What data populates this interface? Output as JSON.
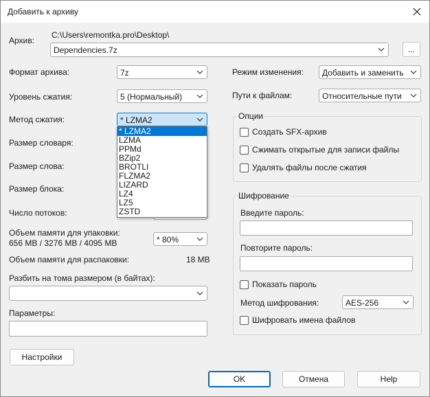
{
  "window": {
    "title": "Добавить к архиву"
  },
  "archive": {
    "label": "Архив:",
    "path": "C:\\Users\\remontka.pro\\Desktop\\",
    "filename": "Dependencies.7z",
    "browse_label": "..."
  },
  "left": {
    "format": {
      "label": "Формат архива:",
      "value": "7z"
    },
    "level": {
      "label": "Уровень сжатия:",
      "value": "5 (Нормальный)"
    },
    "method": {
      "label": "Метод сжатия:",
      "value": "*  LZMA2",
      "options": [
        "*  LZMA2",
        "LZMA",
        "PPMd",
        "BZip2",
        "BROTLI",
        "FLZMA2",
        "LIZARD",
        "LZ4",
        "LZ5",
        "ZSTD"
      ],
      "selected_index": 0
    },
    "dict_label": "Размер словаря:",
    "word_label": "Размер слова:",
    "block_label": "Размер блока:",
    "threads_label": "Число потоков:",
    "mem_pack": {
      "label": "Объем памяти для упаковки:",
      "values": "656 MB / 3276 MB / 4095 MB",
      "percent": "* 80%"
    },
    "mem_unpack": {
      "label": "Объем памяти для распаковки:",
      "value": "18 MB"
    },
    "split": {
      "label": "Разбить на тома размером (в байтах):",
      "value": ""
    },
    "params": {
      "label": "Параметры:",
      "value": ""
    },
    "settings_button": "Настройки"
  },
  "right": {
    "update_mode": {
      "label": "Режим изменения:",
      "value": "Добавить и заменить"
    },
    "paths": {
      "label": "Пути к файлам:",
      "value": "Относительные пути"
    },
    "options": {
      "title": "Опции",
      "sfx": "Создать SFX-архив",
      "shared": "Сжимать открытые для записи файлы",
      "delete": "Удалять файлы после сжатия"
    },
    "encryption": {
      "title": "Шифрование",
      "enter_password": "Введите пароль:",
      "repeat_password": "Повторите пароль:",
      "show_password": "Показать пароль",
      "method_label": "Метод шифрования:",
      "method_value": "AES-256",
      "encrypt_names": "Шифровать имена файлов"
    }
  },
  "buttons": {
    "ok": "OK",
    "cancel": "Отмена",
    "help": "Help"
  }
}
